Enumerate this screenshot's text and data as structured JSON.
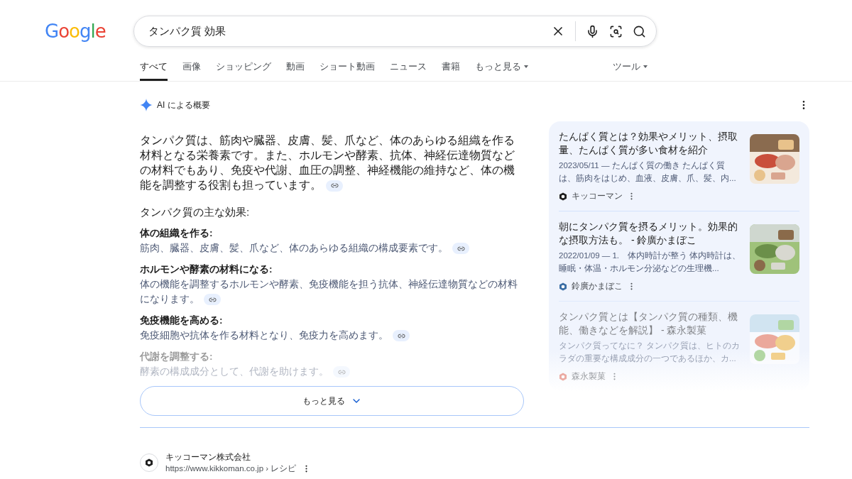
{
  "logo": "Google",
  "search": {
    "value": "タンパク質 効果"
  },
  "tabs": [
    {
      "label": "すべて",
      "selected": true,
      "kind": "tab"
    },
    {
      "label": "画像",
      "selected": false,
      "kind": "tab"
    },
    {
      "label": "ショッピング",
      "selected": false,
      "kind": "tab"
    },
    {
      "label": "動画",
      "selected": false,
      "kind": "tab"
    },
    {
      "label": "ショート動画",
      "selected": false,
      "kind": "tab"
    },
    {
      "label": "ニュース",
      "selected": false,
      "kind": "tab"
    },
    {
      "label": "書籍",
      "selected": false,
      "kind": "tab"
    },
    {
      "label": "もっと見る",
      "selected": false,
      "kind": "menu"
    }
  ],
  "tools": "ツール",
  "ai_overview": {
    "title": "AI による概要",
    "summary": "タンパク質は、筋肉や臓器、皮膚、髪、爪など、体のあらゆる組織を作る材料となる栄養素です。また、ホルモンや酵素、抗体、神経伝達物質などの材料でもあり、免疫や代謝、血圧の調整、神経機能の維持など、体の機能を調整する役割も担っています。",
    "subheading": "タンパク質の主な効果:",
    "points": [
      {
        "heading": "体の組織を作る:",
        "text": "筋肉、臓器、皮膚、髪、爪など、体のあらゆる組織の構成要素です。",
        "faded": false
      },
      {
        "heading": "ホルモンや酵素の材料になる:",
        "text": "体の機能を調整するホルモンや酵素、免疫機能を担う抗体、神経伝達物質などの材料になります。",
        "faded": false
      },
      {
        "heading": "免疫機能を高める:",
        "text": "免疫細胞や抗体を作る材料となり、免疫力を高めます。",
        "faded": false
      },
      {
        "heading": "代謝を調整する:",
        "text": "酵素の構成成分として、代謝を助けます。",
        "faded": true
      }
    ],
    "more_button": "もっと見る",
    "sources": [
      {
        "title": "たんぱく質とは？効果やメリット、摂取量、たんぱく質が多い食材を紹介",
        "snippet": "2023/05/11 — たんぱく質の働き たんぱく質は、筋肉をはじめ、血液、皮膚、爪、髪、内...",
        "site": "キッコーマン",
        "faded": false
      },
      {
        "title": "朝にタンパク質を摂るメリット。効果的な摂取方法も。 - 鈴廣かまぼこ",
        "snippet": "2022/01/09 — 1.　体内時計が整う 体内時計は、睡眠・体温・ホルモン分泌などの生理機...",
        "site": "鈴廣かまぼこ",
        "faded": false
      },
      {
        "title": "タンパク質とは【タンパク質の種類、機能、働きなどを解説】 - 森永製菓",
        "snippet": "タンパク質ってなに？ タンパク質は、ヒトのカラダの重要な構成成分の一つであるほか、カ...",
        "site": "森永製菓",
        "faded": true
      }
    ]
  },
  "result": {
    "site": "キッコーマン株式会社",
    "url": "https://www.kikkoman.co.jp › レシピ"
  }
}
